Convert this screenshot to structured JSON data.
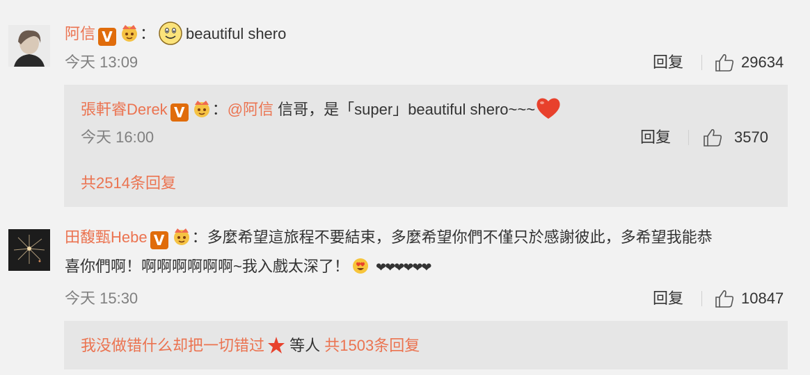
{
  "comments": [
    {
      "username": "阿信",
      "colon": "：",
      "text": "beautiful shero",
      "time": "今天 13:09",
      "reply_label": "回复",
      "likes": "29634",
      "sub_reply": {
        "username": "張軒睿Derek",
        "colon": "：",
        "mention": "@阿信",
        "text": " 信哥，是「super」beautiful shero~~~",
        "time": "今天 16:00",
        "reply_label": "回复",
        "likes": "3570"
      },
      "more_replies": "共2514条回复"
    },
    {
      "username": "田馥甄Hebe",
      "colon": "：",
      "text_line1": "多麼希望這旅程不要結束，多麼希望你們不僅只於感謝彼此，多希望我能恭",
      "text_line2": "喜你們啊！啊啊啊啊啊啊~我入戲太深了！",
      "hearts": "❤❤❤❤❤❤",
      "time": "今天 15:30",
      "reply_label": "回复",
      "likes": "10847",
      "reply_summary": {
        "user": "我没做错什么却把一切错过",
        "etc": " 等人 ",
        "count": "共1503条回复"
      }
    }
  ],
  "colors": {
    "accent": "#eb7350",
    "v_badge": "#e06c0b",
    "background": "#f2f2f2",
    "reply_box": "#e6e6e6"
  },
  "icons": [
    "vip-v-icon",
    "crown-badge-icon",
    "smile-emoji-icon",
    "heart-emoji-icon",
    "heart-eyes-emoji-icon",
    "star-icon",
    "thumbs-up-icon"
  ]
}
